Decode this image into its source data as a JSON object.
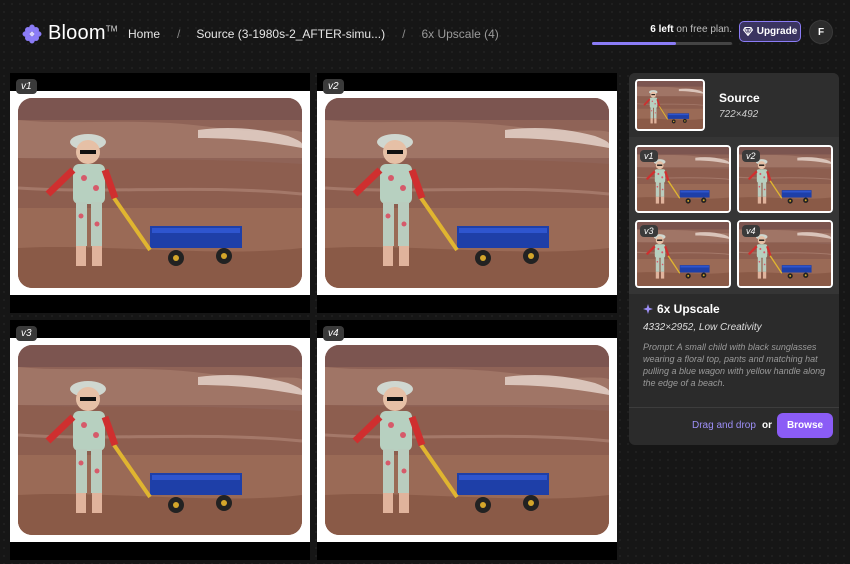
{
  "app": {
    "name": "Bloom",
    "trademark": "TM"
  },
  "breadcrumb": {
    "home": "Home",
    "source": "Source (3-1980s-2_AFTER-simu...)",
    "current": "6x Upscale (4)"
  },
  "plan": {
    "left_count": "6 left",
    "left_suffix": " on free plan.",
    "usage_fraction": 0.6
  },
  "upgrade_label": "Upgrade",
  "avatar_initial": "F",
  "versions": [
    {
      "label": "v1"
    },
    {
      "label": "v2"
    },
    {
      "label": "v3"
    },
    {
      "label": "v4"
    }
  ],
  "panel": {
    "source_title": "Source",
    "source_dims": "722×492",
    "thumbs": [
      "v1",
      "v2",
      "v3",
      "v4"
    ],
    "upscale_title": "6x Upscale",
    "upscale_meta": "4332×2952, Low Creativity",
    "prompt": "Prompt: A small child with black sunglasses wearing a floral top, pants and matching hat pulling a blue wagon with yellow handle along the edge of a beach.",
    "drag_label": "Drag and drop",
    "or_label": "or",
    "browse_label": "Browse"
  },
  "colors": {
    "accent": "#8b5cf6",
    "accent_soft": "#9d8ff7",
    "bg": "#161616"
  },
  "icons": [
    "flower-logo-icon",
    "gem-icon",
    "sparkle-icon"
  ]
}
